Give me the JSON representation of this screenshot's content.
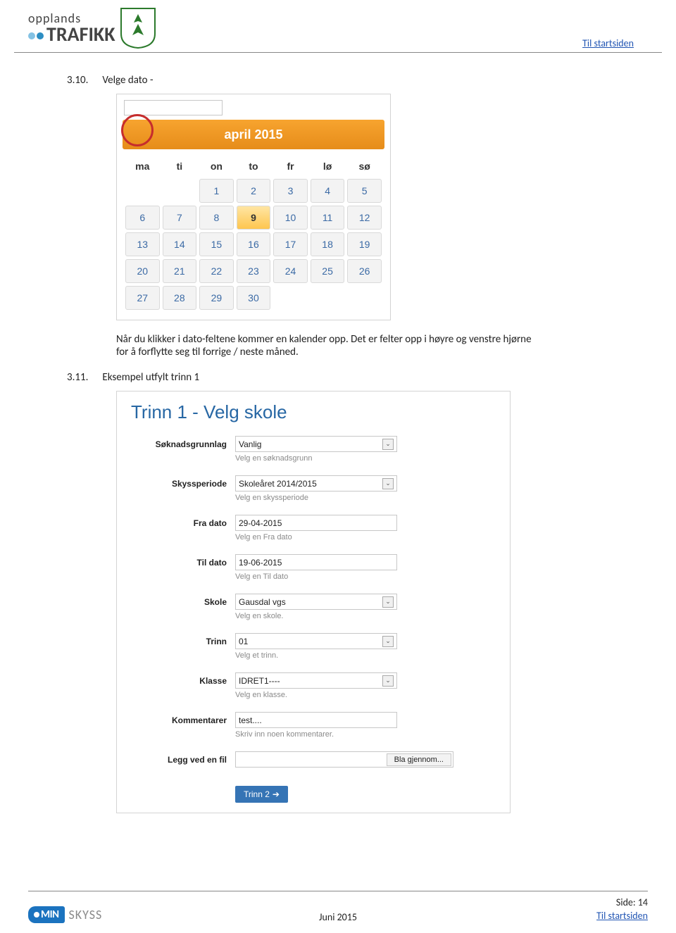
{
  "header": {
    "logo_small": "opplands",
    "logo_big": "TRAFIKK",
    "top_link": "Til startsiden"
  },
  "section310": {
    "num": "3.10.",
    "title": "Velge dato -",
    "calendar": {
      "month_label": "april 2015",
      "weekdays": [
        "ma",
        "ti",
        "on",
        "to",
        "fr",
        "lø",
        "sø"
      ],
      "weeks": [
        [
          "",
          "",
          "1",
          "2",
          "3",
          "4",
          "5"
        ],
        [
          "6",
          "7",
          "8",
          "9",
          "10",
          "11",
          "12"
        ],
        [
          "13",
          "14",
          "15",
          "16",
          "17",
          "18",
          "19"
        ],
        [
          "20",
          "21",
          "22",
          "23",
          "24",
          "25",
          "26"
        ],
        [
          "27",
          "28",
          "29",
          "30",
          "",
          "",
          ""
        ]
      ],
      "today": "9"
    },
    "body_text": "Når du klikker i dato-feltene kommer en kalender opp. Det er felter opp i høyre og venstre hjørne for å forflytte seg til forrige / neste måned."
  },
  "section311": {
    "num": "3.11.",
    "title": "Eksempel utfylt trinn 1",
    "form": {
      "title": "Trinn 1 - Velg skole",
      "fields": [
        {
          "label": "Søknadsgrunnlag",
          "type": "select",
          "value": "Vanlig",
          "help": "Velg en søknadsgrunn"
        },
        {
          "label": "Skyssperiode",
          "type": "select",
          "value": "Skoleåret 2014/2015",
          "help": "Velg en skyssperiode"
        },
        {
          "label": "Fra dato",
          "type": "input",
          "value": "29-04-2015",
          "help": "Velg en Fra dato"
        },
        {
          "label": "Til dato",
          "type": "input",
          "value": "19-06-2015",
          "help": "Velg en Til dato"
        },
        {
          "label": "Skole",
          "type": "select",
          "value": "Gausdal vgs",
          "help": "Velg en skole."
        },
        {
          "label": "Trinn",
          "type": "select",
          "value": "01",
          "help": "Velg et trinn."
        },
        {
          "label": "Klasse",
          "type": "select",
          "value": "IDRET1----",
          "help": "Velg en klasse."
        },
        {
          "label": "Kommentarer",
          "type": "input",
          "value": "test....",
          "help": "Skriv inn noen kommentarer."
        },
        {
          "label": "Legg ved en fil",
          "type": "file",
          "value": "Bla gjennom...",
          "help": ""
        }
      ],
      "next_button": "Trinn 2"
    }
  },
  "footer": {
    "brand_min": "MIN",
    "brand_skyss": "SKYSS",
    "center": "Juni 2015",
    "page_label": "Side:  14",
    "link": "Til startsiden"
  }
}
